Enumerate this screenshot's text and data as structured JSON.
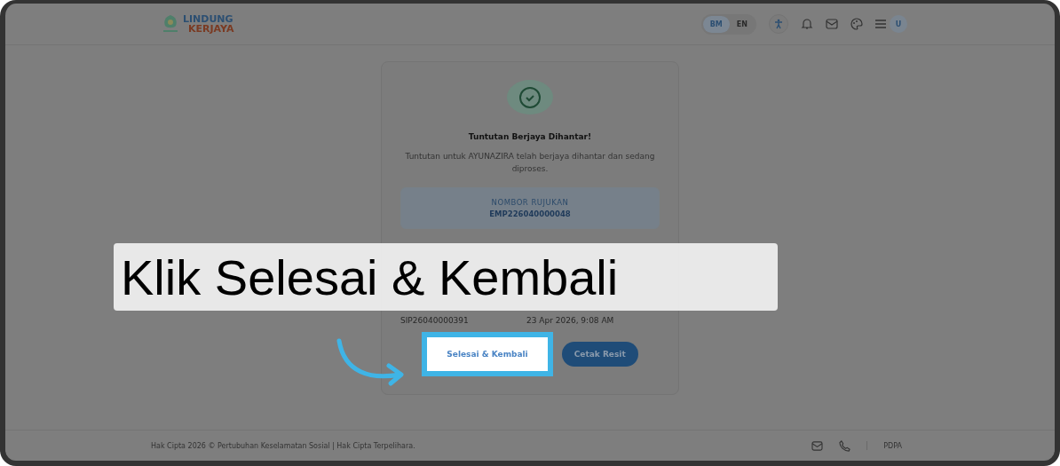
{
  "header": {
    "logo_top": "LINDUNG",
    "logo_bottom": "KERJAYA",
    "languages": [
      {
        "label": "BM",
        "selected": true
      },
      {
        "label": "EN",
        "selected": false
      }
    ],
    "avatar": "U"
  },
  "card": {
    "title": "Tuntutan Berjaya Dihantar!",
    "message": "Tuntutan untuk AYUNAZIRA telah berjaya dihantar dan sedang diproses.",
    "reference_label": "NOMBOR RUJUKAN",
    "reference_number": "EMP226040000048",
    "details": [
      {
        "value": "SIP26040000391"
      },
      {
        "value": "23 Apr 2026, 9:08 AM"
      }
    ],
    "buttons": [
      {
        "label": "Selesai & Kembali",
        "kind": "secondary",
        "highlighted": true
      },
      {
        "label": "Cetak Resit",
        "kind": "primary",
        "highlighted": false
      }
    ]
  },
  "caption": "Klik Selesai & Kembali",
  "footer": {
    "copyright": "Hak Cipta 2026 © Pertubuhan Keselamatan Sosial | Hak Cipta Terpelihara.",
    "link": "PDPA"
  }
}
